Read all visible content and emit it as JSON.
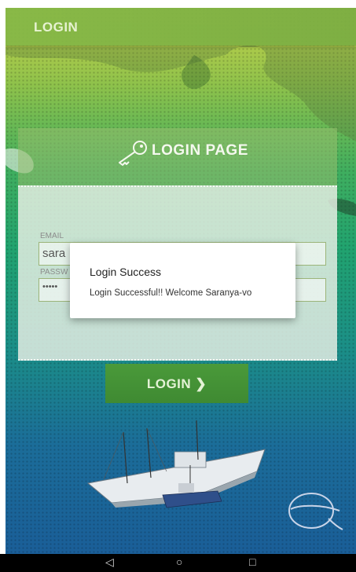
{
  "appbar": {
    "title": "LOGIN"
  },
  "panel": {
    "title": "LOGIN PAGE"
  },
  "form": {
    "email_label": "EMAIL",
    "email_value": "sara",
    "password_label": "PASSW",
    "password_value": "•••••"
  },
  "login_button": {
    "label": "LOGIN ❯"
  },
  "dialog": {
    "title": "Login Success",
    "message": "Login Successful!! Welcome Saranya-vo"
  },
  "navbar": {
    "back": "◁",
    "home": "○",
    "recents": "□"
  },
  "colors": {
    "appbar": "#7cae43",
    "button": "#4a9a3a",
    "dialog_bg": "#ffffff"
  }
}
